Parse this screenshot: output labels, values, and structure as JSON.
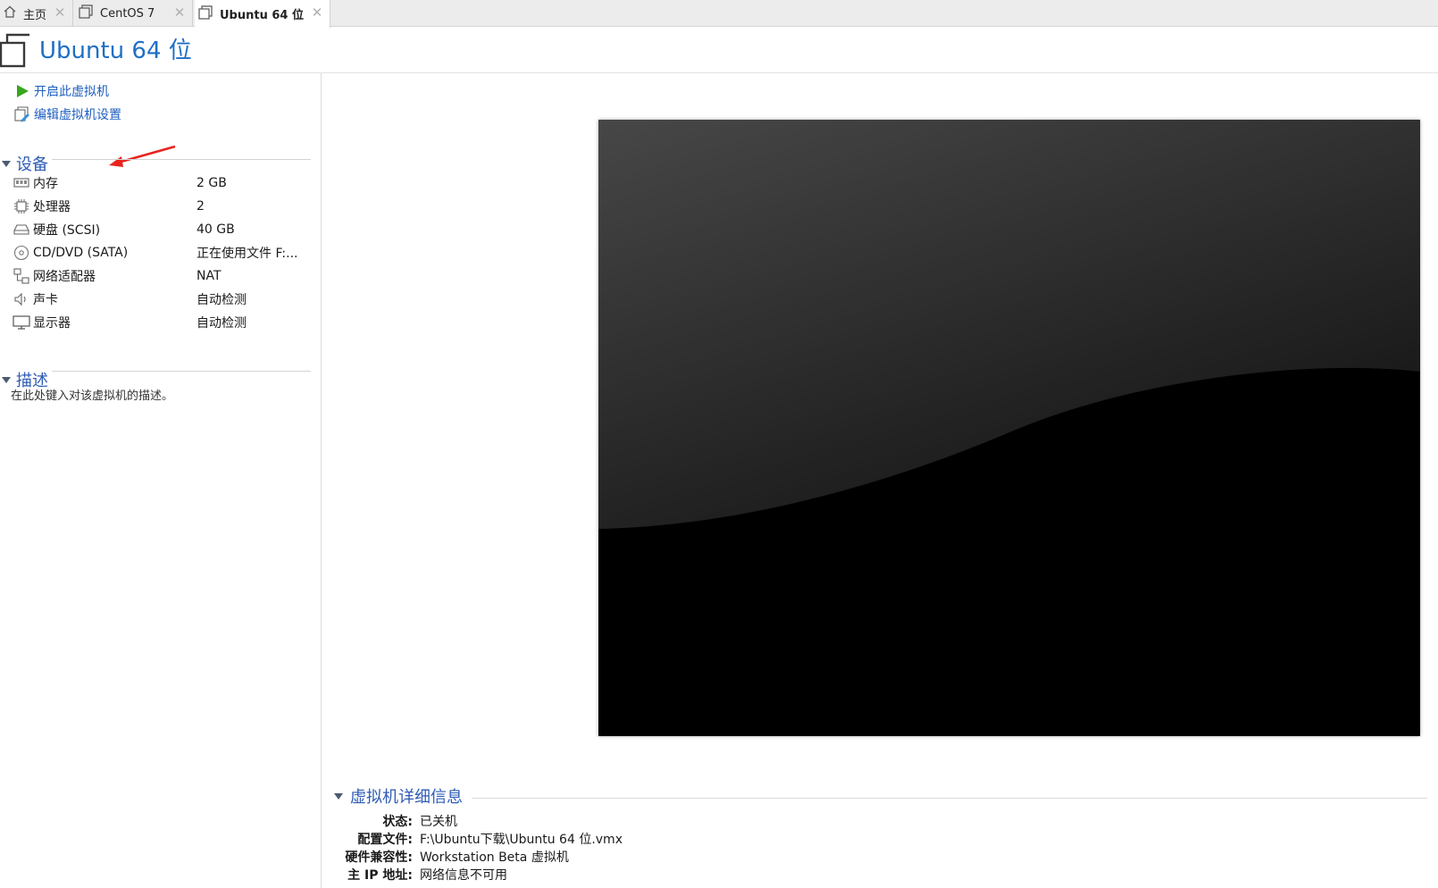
{
  "tabs": [
    {
      "label": "主页",
      "icon": "home-icon"
    },
    {
      "label": "CentOS 7",
      "icon": "vm-icon"
    },
    {
      "label": "Ubuntu 64 位",
      "icon": "vm-icon",
      "active": true
    }
  ],
  "vm": {
    "title": "Ubuntu 64 位"
  },
  "actions": {
    "start": "开启此虚拟机",
    "edit": "编辑虚拟机设置"
  },
  "devices": {
    "heading": "设备",
    "items": [
      {
        "name": "内存",
        "value": "2 GB",
        "icon": "memory-icon"
      },
      {
        "name": "处理器",
        "value": "2",
        "icon": "cpu-icon"
      },
      {
        "name": "硬盘 (SCSI)",
        "value": "40 GB",
        "icon": "harddisk-icon"
      },
      {
        "name": "CD/DVD (SATA)",
        "value": "正在使用文件 F:...",
        "icon": "cd-dvd-icon"
      },
      {
        "name": "网络适配器",
        "value": "NAT",
        "icon": "network-icon"
      },
      {
        "name": "声卡",
        "value": "自动检测",
        "icon": "speaker-icon"
      },
      {
        "name": "显示器",
        "value": "自动检测",
        "icon": "monitor-icon"
      }
    ]
  },
  "description": {
    "heading": "描述",
    "placeholder": "在此处键入对该虚拟机的描述。"
  },
  "details": {
    "heading": "虚拟机详细信息",
    "rows": [
      {
        "key": "状态:",
        "value": "已关机"
      },
      {
        "key": "配置文件:",
        "value": "F:\\Ubuntu下载\\Ubuntu 64 位.vmx"
      },
      {
        "key": "硬件兼容性:",
        "value": "Workstation Beta 虚拟机"
      },
      {
        "key": "主 IP 地址:",
        "value": "网络信息不可用"
      }
    ]
  },
  "colors": {
    "accent": "#1f6fc5",
    "link": "#1f5fbf",
    "section": "#2e5bb5",
    "annotation_arrow": "#e8231c"
  }
}
